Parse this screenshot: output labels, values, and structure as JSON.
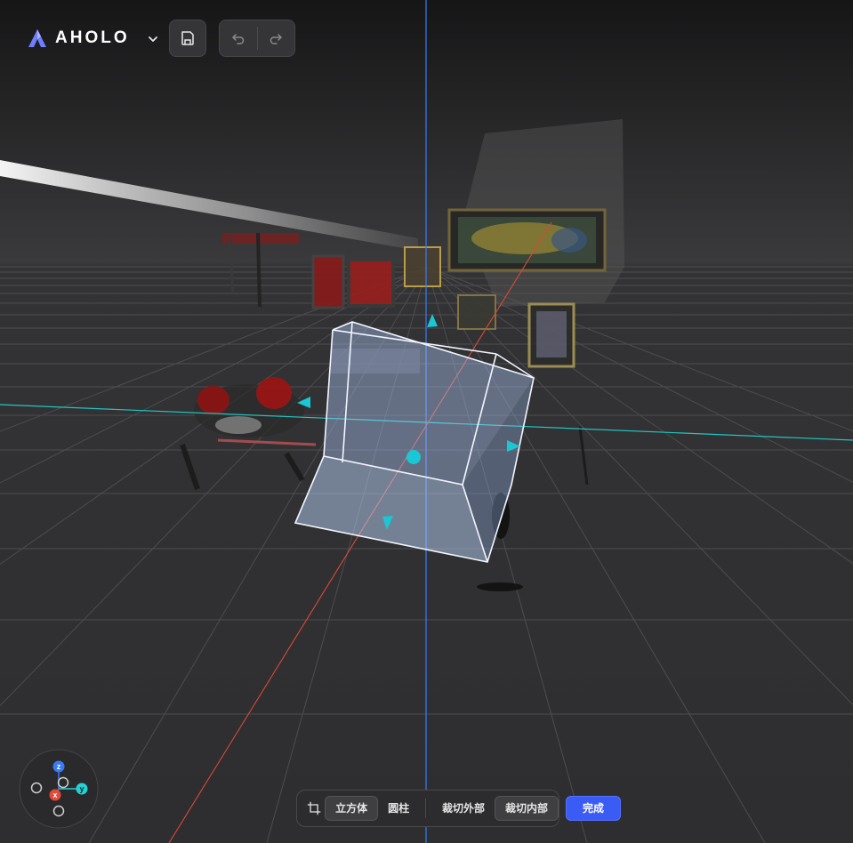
{
  "app": {
    "logo_text": "AHOLO"
  },
  "toolbar": {
    "save_icon": "save-icon",
    "undo_icon": "undo-icon",
    "redo_icon": "redo-icon",
    "dropdown_icon": "chevron-down-icon"
  },
  "axis_gizmo": {
    "z_label": "z",
    "x_label": "x",
    "y_label": "y"
  },
  "crop_toolbar": {
    "crop_icon": "crop-icon",
    "shape_cube": "立方体",
    "shape_cylinder": "圆柱",
    "crop_outside": "裁切外部",
    "crop_inside": "裁切内部",
    "done": "完成"
  },
  "colors": {
    "accent": "#3a5cf5",
    "handle": "#19c8d4",
    "axis_x": "#e24a3b",
    "axis_y": "#22d3d3",
    "axis_z": "#3a7bf5"
  }
}
